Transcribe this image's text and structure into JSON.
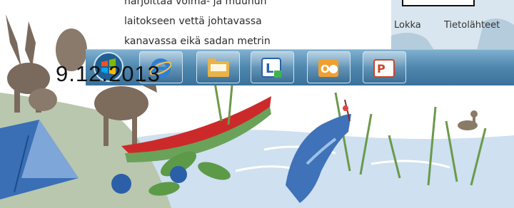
{
  "document": {
    "lines": [
      "harjoittaa voima- ja muunun",
      "laitokseen vettä johtavassa",
      "kanavassa eikä sadan metrin"
    ]
  },
  "map_panel": {
    "labels": [
      "Lokka",
      "Tietolähteet"
    ]
  },
  "taskbar": {
    "start_icon": "windows-start-orb",
    "apps": [
      {
        "name": "internet-explorer",
        "icon": "internet-explorer-icon"
      },
      {
        "name": "file-explorer",
        "icon": "folder-icon"
      },
      {
        "name": "lync",
        "icon": "lync-icon"
      },
      {
        "name": "outlook",
        "icon": "outlook-icon"
      },
      {
        "name": "powerpoint",
        "icon": "powerpoint-icon"
      }
    ]
  },
  "clock": {
    "text": "9.12.2013"
  },
  "colors": {
    "sky": "#ffffff",
    "water": "#cfe0f0",
    "canoe": "#cc2a2a",
    "tent": "#3a6fb5",
    "reeds": "#6a9a4a",
    "taskbar": "#4e86ad"
  }
}
